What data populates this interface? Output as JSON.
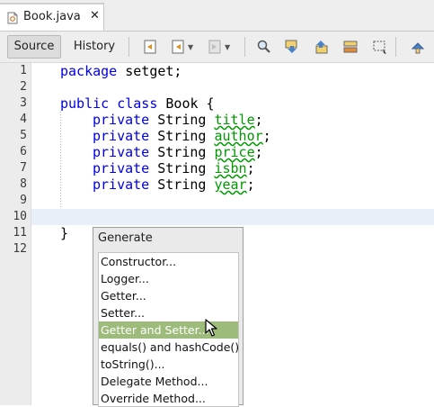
{
  "tab": {
    "label": "Book.java",
    "close": "✕"
  },
  "toolbar": {
    "source_label": "Source",
    "history_label": "History"
  },
  "editor": {
    "line_numbers": [
      "1",
      "2",
      "3",
      "4",
      "5",
      "6",
      "7",
      "8",
      "9",
      "10",
      "11",
      "12"
    ],
    "package_kw": "package",
    "package_name": " setget;",
    "class_kw1": "public",
    "class_kw2": "class",
    "class_rest": " Book {",
    "private_kw": "private",
    "type": "String",
    "fields": [
      "title",
      "author",
      "price",
      "isbn",
      "year"
    ],
    "semicolon": ";",
    "close_brace": "}"
  },
  "popup": {
    "title": "Generate",
    "items": [
      "Constructor...",
      "Logger...",
      "Getter...",
      "Setter...",
      "Getter and Setter...",
      "equals() and hashCode()...",
      "toString()...",
      "Delegate Method...",
      "Override Method..."
    ],
    "selected": "Getter and Setter..."
  }
}
